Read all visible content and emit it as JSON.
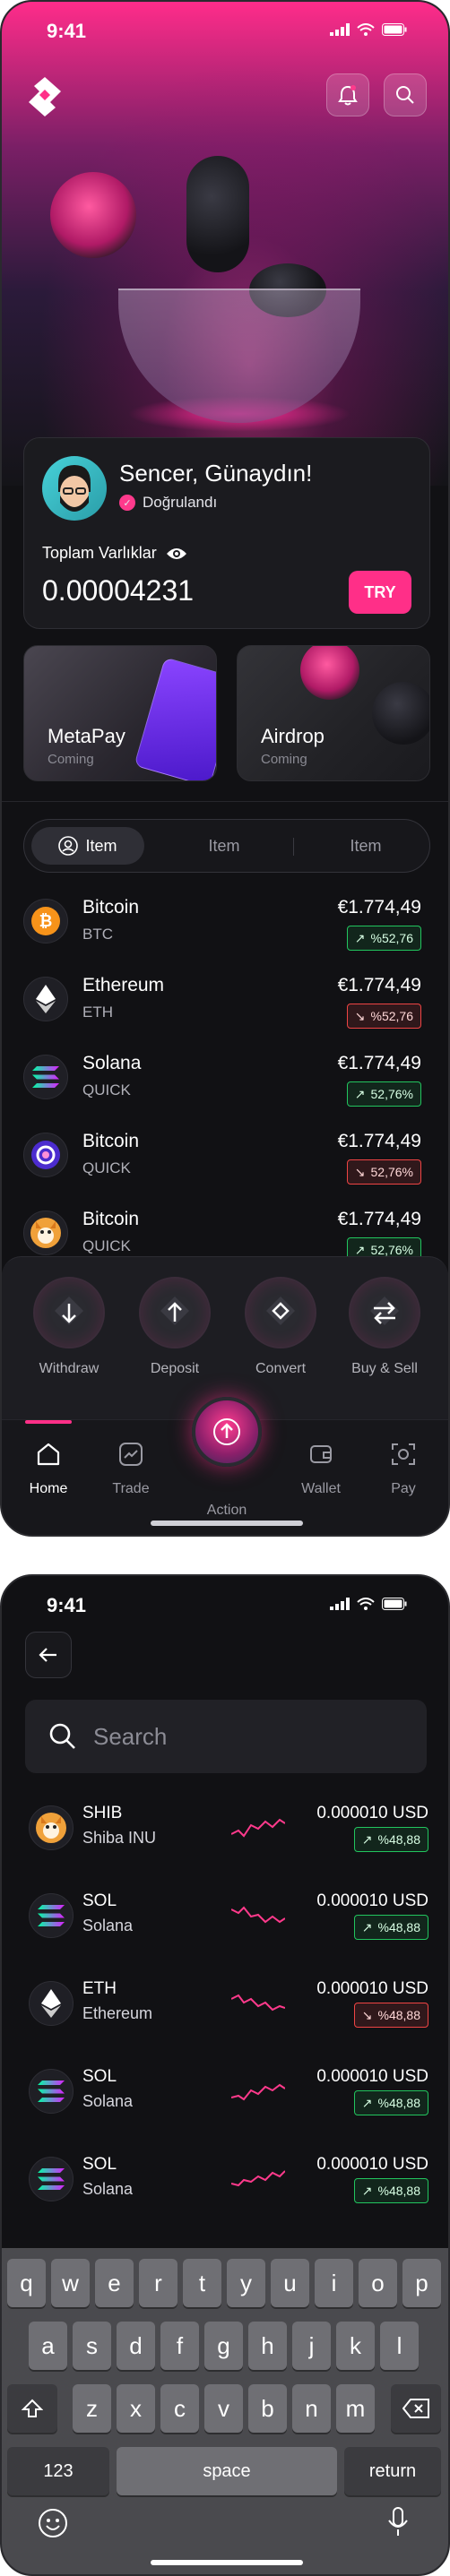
{
  "status": {
    "time": "9:41"
  },
  "home": {
    "greeting": "Sencer, Günaydın!",
    "verified": "Doğrulandı",
    "assets_label": "Toplam Varlıklar",
    "balance": "0.00004231",
    "currency_button": "TRY",
    "promos": [
      {
        "title": "MetaPay",
        "subtitle": "Coming"
      },
      {
        "title": "Airdrop",
        "subtitle": "Coming"
      }
    ],
    "tabs": [
      "Item",
      "Item",
      "Item"
    ],
    "coins": [
      {
        "name": "Bitcoin",
        "symbol": "BTC",
        "price": "€1.774,49",
        "change": "%52,76",
        "direction": "up",
        "icon": "bitcoin-icon",
        "color": "#f7931a"
      },
      {
        "name": "Ethereum",
        "symbol": "ETH",
        "price": "€1.774,49",
        "change": "%52,76",
        "direction": "down",
        "icon": "ethereum-icon",
        "color": "#ffffff"
      },
      {
        "name": "Solana",
        "symbol": "QUICK",
        "price": "€1.774,49",
        "change": "52,76%",
        "direction": "up",
        "icon": "solana-icon",
        "color": "#9945ff"
      },
      {
        "name": "Bitcoin",
        "symbol": "QUICK",
        "price": "€1.774,49",
        "change": "52,76%",
        "direction": "down",
        "icon": "quickswap-icon",
        "color": "#6a4cff"
      },
      {
        "name": "Bitcoin",
        "symbol": "QUICK",
        "price": "€1.774,49",
        "change": "52,76%",
        "direction": "up",
        "icon": "shiba-icon",
        "color": "#f0a13a"
      }
    ],
    "actions": [
      "Withdraw",
      "Deposit",
      "Convert",
      "Buy & Sell"
    ],
    "tabbar": [
      "Home",
      "Trade",
      "Action",
      "Wallet",
      "Pay"
    ]
  },
  "search_screen": {
    "placeholder": "Search",
    "results": [
      {
        "symbol": "SHIB",
        "name": "Shiba INU",
        "price": "0.000010 USD",
        "change": "%48,88",
        "direction": "up",
        "icon": "shiba-icon"
      },
      {
        "symbol": "SOL",
        "name": "Solana",
        "price": "0.000010 USD",
        "change": "%48,88",
        "direction": "up",
        "icon": "solana-icon"
      },
      {
        "symbol": "ETH",
        "name": "Ethereum",
        "price": "0.000010 USD",
        "change": "%48,88",
        "direction": "down",
        "icon": "ethereum-icon"
      },
      {
        "symbol": "SOL",
        "name": "Solana",
        "price": "0.000010 USD",
        "change": "%48,88",
        "direction": "up",
        "icon": "solana-icon"
      },
      {
        "symbol": "SOL",
        "name": "Solana",
        "price": "0.000010 USD",
        "change": "%48,88",
        "direction": "up",
        "icon": "solana-icon"
      }
    ]
  },
  "keyboard": {
    "row1": [
      "q",
      "w",
      "e",
      "r",
      "t",
      "y",
      "u",
      "i",
      "o",
      "p"
    ],
    "row2": [
      "a",
      "s",
      "d",
      "f",
      "g",
      "h",
      "j",
      "k",
      "l"
    ],
    "row3": [
      "z",
      "x",
      "c",
      "v",
      "b",
      "n",
      "m"
    ],
    "numbers_key": "123",
    "space_key": "space",
    "return_key": "return"
  },
  "colors": {
    "accent": "#ff2f88",
    "up": "#22c55e",
    "down": "#ef4444",
    "background": "#111114"
  }
}
